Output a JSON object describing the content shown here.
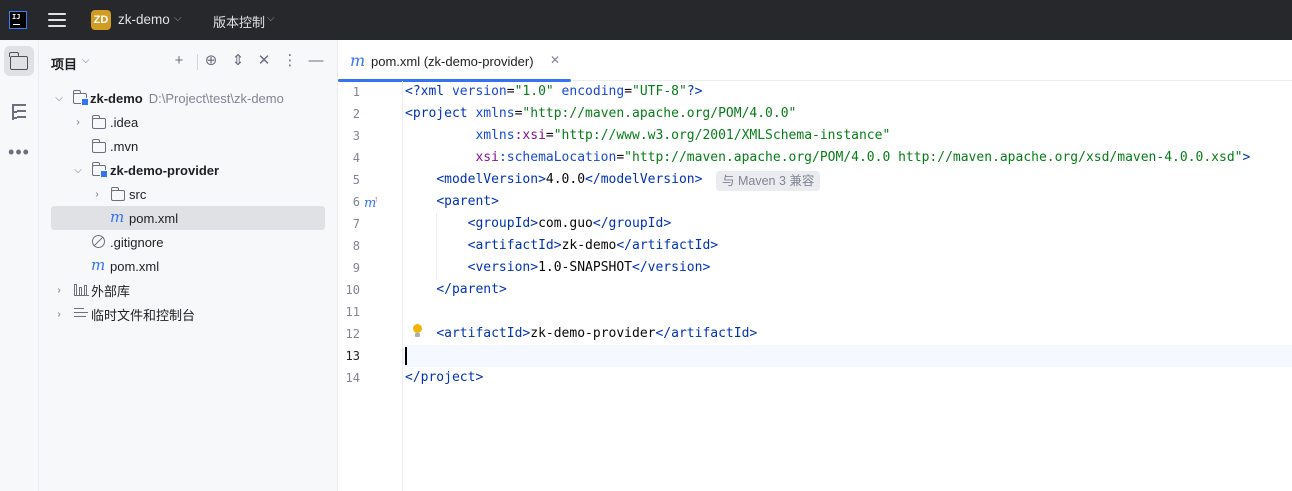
{
  "titlebar": {
    "project_badge": "ZD",
    "project_name": "zk-demo",
    "vcs_label": "版本控制"
  },
  "project_panel": {
    "title": "项目",
    "tree": [
      {
        "label": "zk-demo",
        "path": "D:\\Project\\test\\zk-demo",
        "icon": "module-folder-icon",
        "expanded": true,
        "bold": true
      },
      {
        "label": ".idea",
        "icon": "folder-icon",
        "expanded": false
      },
      {
        "label": ".mvn",
        "icon": "folder-icon"
      },
      {
        "label": "zk-demo-provider",
        "icon": "module-folder-icon",
        "expanded": true,
        "bold": true
      },
      {
        "label": "src",
        "icon": "folder-icon",
        "expanded": false
      },
      {
        "label": "pom.xml",
        "icon": "maven-file-icon",
        "selected": true
      },
      {
        "label": ".gitignore",
        "icon": "ignore-file-icon"
      },
      {
        "label": "pom.xml",
        "icon": "maven-file-icon"
      },
      {
        "label": "外部库",
        "icon": "library-icon",
        "expanded": false
      },
      {
        "label": "临时文件和控制台",
        "icon": "scratches-icon",
        "expanded": false
      }
    ]
  },
  "editor": {
    "tab_label": "pom.xml (zk-demo-provider)",
    "current_line": 13,
    "inlay_hint": "与 Maven 3 兼容",
    "line_numbers": [
      "1",
      "2",
      "3",
      "4",
      "5",
      "6",
      "7",
      "8",
      "9",
      "10",
      "11",
      "12",
      "13",
      "14"
    ],
    "lines": {
      "l1_decl_open": "<?",
      "l1_xml": "xml",
      "l1_version_attr": " version",
      "l1_version_val": "\"1.0\"",
      "l1_encoding_attr": " encoding",
      "l1_encoding_val": "\"UTF-8\"",
      "l1_decl_close": "?>",
      "l2_open": "<",
      "l2_tag": "project",
      "l2_attr": " xmlns",
      "l2_val": "\"http://maven.apache.org/POM/4.0.0\"",
      "l3_ns": "xmlns",
      "l3_attr": ":xsi",
      "l3_val": "\"http://www.w3.org/2001/XMLSchema-instance\"",
      "l4_ns": "xsi",
      "l4_attr": ":schemaLocation",
      "l4_val": "\"http://maven.apache.org/POM/4.0.0 http://maven.apache.org/xsd/maven-4.0.0.xsd\"",
      "l4_close": ">",
      "l5_tag": "modelVersion",
      "l5_text": "4.0.0",
      "l6_tag": "parent",
      "l7_tag": "groupId",
      "l7_text": "com.guo",
      "l8_tag": "artifactId",
      "l8_text": "zk-demo",
      "l9_tag": "version",
      "l9_text": "1.0-SNAPSHOT",
      "l10_tag": "parent",
      "l12_tag": "artifactId",
      "l12_text": "zk-demo-provider",
      "l14_tag": "project"
    }
  },
  "colors": {
    "accent": "#3574f0",
    "tag": "#0033b3",
    "string": "#067d17",
    "namespace": "#871094"
  }
}
